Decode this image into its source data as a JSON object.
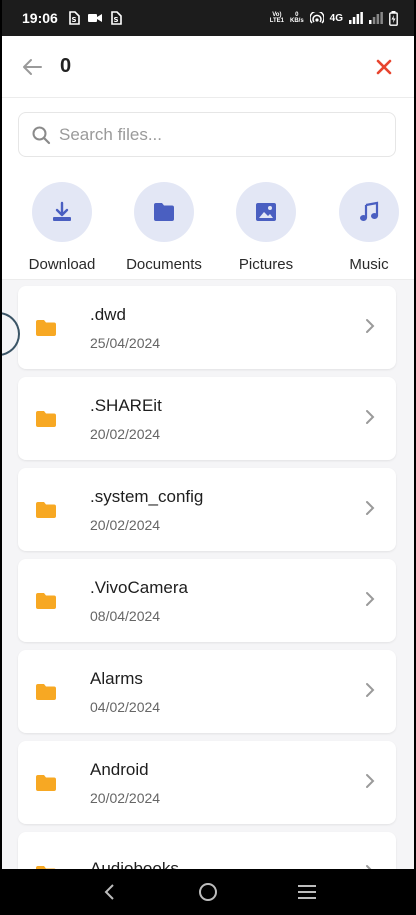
{
  "status_bar": {
    "time": "19:06",
    "volte": "Vo)\nLTE1",
    "speed_value": "0",
    "speed_unit": "KB/s",
    "network": "4G"
  },
  "header": {
    "title": "0",
    "back_icon": "arrow-left-icon",
    "close_icon": "close-icon",
    "close_color": "#e8442e"
  },
  "search": {
    "placeholder": "Search files...",
    "value": ""
  },
  "quick_access": [
    {
      "label": "Download",
      "icon": "download-icon"
    },
    {
      "label": "Documents",
      "icon": "folder-icon"
    },
    {
      "label": "Pictures",
      "icon": "image-icon"
    },
    {
      "label": "Music",
      "icon": "music-icon"
    }
  ],
  "files": [
    {
      "name": ".dwd",
      "date": "25/04/2024"
    },
    {
      "name": ".SHAREit",
      "date": "20/02/2024"
    },
    {
      "name": ".system_config",
      "date": "20/02/2024"
    },
    {
      "name": ".VivoCamera",
      "date": "08/04/2024"
    },
    {
      "name": "Alarms",
      "date": "04/02/2024"
    },
    {
      "name": "Android",
      "date": "20/02/2024"
    },
    {
      "name": "Audiobooks",
      "date": ""
    }
  ],
  "colors": {
    "accent": "#4a5fc1",
    "folder": "#f7a823",
    "close": "#e8442e"
  }
}
